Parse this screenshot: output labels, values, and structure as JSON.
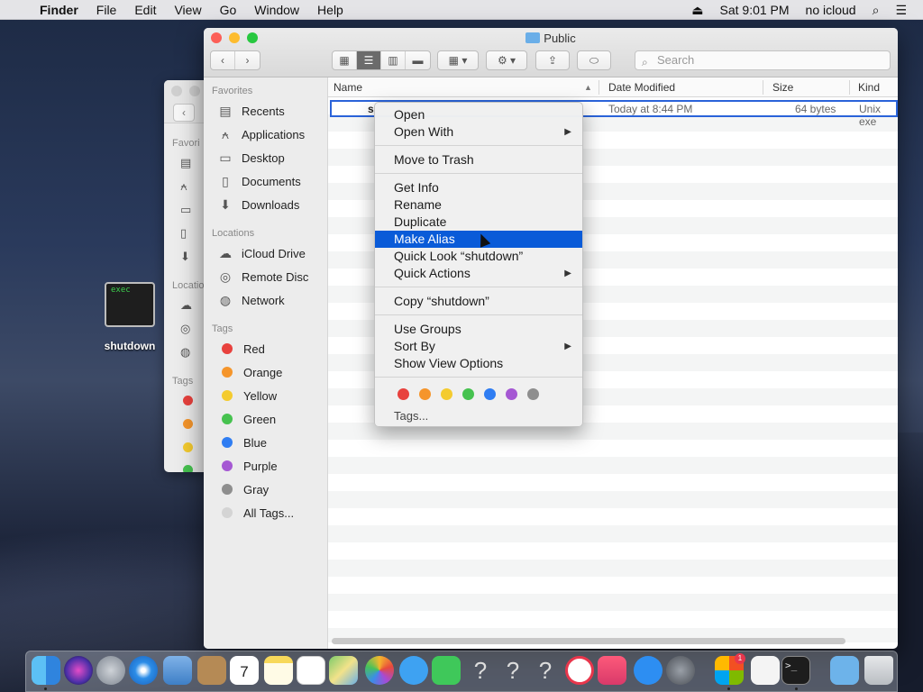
{
  "menubar": {
    "app": "Finder",
    "items": [
      "File",
      "Edit",
      "View",
      "Go",
      "Window",
      "Help"
    ],
    "clock": "Sat 9:01 PM",
    "user": "no icloud"
  },
  "window": {
    "title": "Public",
    "search_placeholder": "Search"
  },
  "sidebar": {
    "favorites_label": "Favorites",
    "favorites": [
      "Recents",
      "Applications",
      "Desktop",
      "Documents",
      "Downloads"
    ],
    "locations_label": "Locations",
    "locations": [
      "iCloud Drive",
      "Remote Disc",
      "Network"
    ],
    "tags_label": "Tags",
    "tags": [
      {
        "name": "Red",
        "color": "#e8413d"
      },
      {
        "name": "Orange",
        "color": "#f5952b"
      },
      {
        "name": "Yellow",
        "color": "#f4cb2f"
      },
      {
        "name": "Green",
        "color": "#46c24f"
      },
      {
        "name": "Blue",
        "color": "#2f7df2"
      },
      {
        "name": "Purple",
        "color": "#a558d3"
      },
      {
        "name": "Gray",
        "color": "#8e8e8e"
      },
      {
        "name": "All Tags...",
        "color": "#d4d4d4"
      }
    ]
  },
  "back_window": {
    "favorites_label": "Favori",
    "locations_label": "Locatio",
    "tags_label": "Tags"
  },
  "columns": {
    "name": "Name",
    "modified": "Date Modified",
    "size": "Size",
    "kind": "Kind"
  },
  "file": {
    "name_initial": "s",
    "modified": "Today at 8:44 PM",
    "size": "64 bytes",
    "kind": "Unix exe"
  },
  "context_menu": {
    "open": "Open",
    "open_with": "Open With",
    "move_to_trash": "Move to Trash",
    "get_info": "Get Info",
    "rename": "Rename",
    "duplicate": "Duplicate",
    "make_alias": "Make Alias",
    "quick_look": "Quick Look “shutdown”",
    "quick_actions": "Quick Actions",
    "copy": "Copy “shutdown”",
    "use_groups": "Use Groups",
    "sort_by": "Sort By",
    "show_view_options": "Show View Options",
    "tags": "Tags...",
    "tag_colors": [
      "#e8413d",
      "#f5952b",
      "#f4cb2f",
      "#46c24f",
      "#2f7df2",
      "#a558d3",
      "#8e8e8e"
    ]
  },
  "desktop_file": {
    "icon_text": "exec",
    "label": "shutdown"
  },
  "dock": {
    "calendar_day": "7",
    "icons": [
      "finder-icon",
      "siri-icon",
      "launchpad-icon",
      "safari-icon",
      "preview-icon",
      "contacts-icon",
      "calendar-icon",
      "notes-icon",
      "reminders-icon",
      "maps-icon",
      "photos-icon",
      "messages-icon",
      "facetime-icon",
      "unknown-app-icon",
      "unknown-app-icon",
      "unknown-app-icon",
      "news-icon",
      "music-icon",
      "app-store-icon",
      "system-preferences-icon",
      "office-icon",
      "textedit-icon",
      "terminal-icon",
      "downloads-folder-icon",
      "trash-icon"
    ],
    "badge": "1"
  }
}
